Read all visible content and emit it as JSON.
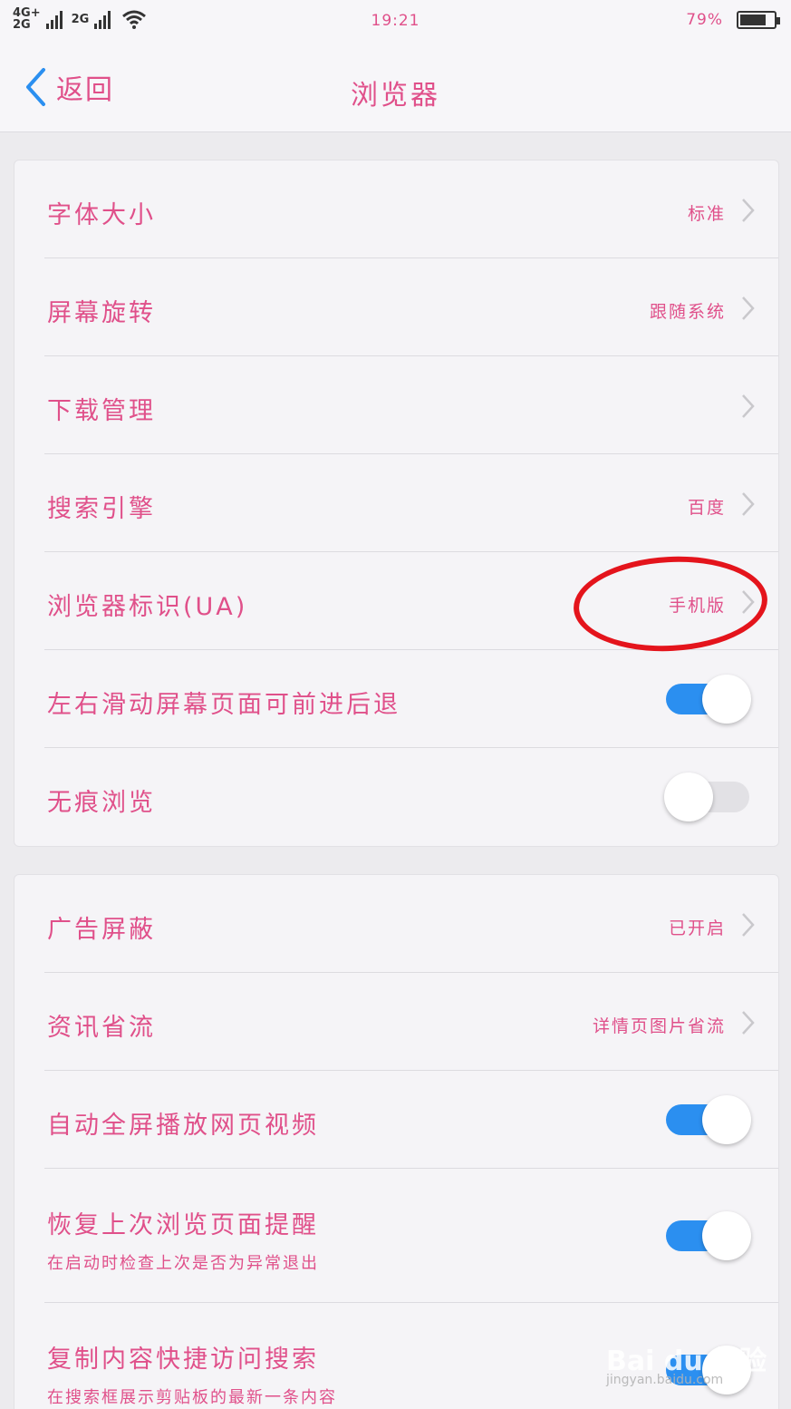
{
  "status_bar": {
    "network_top": "4G+",
    "network_bottom": "2G",
    "network_second": "2G",
    "time": "19:21",
    "battery_percent": "79%",
    "battery_level": 0.79,
    "icons": [
      "signal-icon",
      "wifi-icon",
      "battery-icon"
    ]
  },
  "nav": {
    "back_label": "返回",
    "title": "浏览器",
    "back_icon": "chevron-left-icon",
    "back_icon_color": "#2b8ff0"
  },
  "section1": {
    "rows": [
      {
        "label": "字体大小",
        "value": "标准",
        "type": "link"
      },
      {
        "label": "屏幕旋转",
        "value": "跟随系统",
        "type": "link"
      },
      {
        "label": "下载管理",
        "value": "",
        "type": "link"
      },
      {
        "label": "搜索引擎",
        "value": "百度",
        "type": "link"
      },
      {
        "label": "浏览器标识(UA)",
        "value": "手机版",
        "type": "link"
      },
      {
        "label": "左右滑动屏幕页面可前进后退",
        "type": "toggle",
        "on": true
      },
      {
        "label": "无痕浏览",
        "type": "toggle",
        "on": false
      }
    ]
  },
  "section2": {
    "rows": [
      {
        "label": "广告屏蔽",
        "value": "已开启",
        "type": "link"
      },
      {
        "label": "资讯省流",
        "value": "详情页图片省流",
        "type": "link"
      },
      {
        "label": "自动全屏播放网页视频",
        "type": "toggle",
        "on": true
      },
      {
        "label": "恢复上次浏览页面提醒",
        "sublabel": "在启动时检查上次是否为异常退出",
        "type": "toggle",
        "on": true
      },
      {
        "label": "复制内容快捷访问搜索",
        "sublabel": "在搜索框展示剪贴板的最新一条内容",
        "type": "toggle",
        "on": true
      }
    ]
  },
  "watermark": {
    "logo": "Bai du 经验",
    "url": "jingyan.baidu.com"
  },
  "colors": {
    "text_accent": "#e0508a",
    "toggle_on": "#2b8ff0",
    "toggle_off": "#e2e1e5",
    "annotation": "#e4141c",
    "background": "#ecebee",
    "card": "#f5f4f7"
  }
}
